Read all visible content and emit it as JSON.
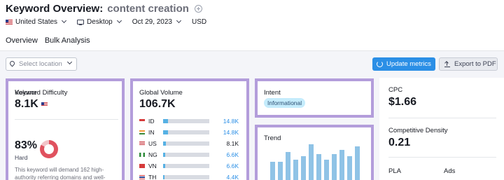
{
  "header": {
    "title": "Keyword Overview:",
    "keyword": "content creation",
    "filters": {
      "country": "United States",
      "device": "Desktop",
      "date": "Oct 29, 2023",
      "currency": "USD"
    }
  },
  "tabs": [
    {
      "label": "Overview",
      "active": true
    },
    {
      "label": "Bulk Analysis",
      "active": false
    }
  ],
  "toolbar": {
    "location_placeholder": "Select location",
    "update_label": "Update metrics",
    "export_label": "Export to PDF"
  },
  "volume": {
    "label": "Volume",
    "value": "8.1K",
    "kd_label": "Keyword Difficulty",
    "kd_value": "83%",
    "kd_level": "Hard",
    "kd_percent": 83,
    "kd_note": "This keyword will demand 162 high-authority referring domains and well-"
  },
  "global_volume": {
    "label": "Global Volume",
    "value": "106.7K",
    "rows": [
      {
        "code": "ID",
        "value": "14.8K",
        "share": 0.14,
        "link": true,
        "flag": "id"
      },
      {
        "code": "IN",
        "value": "14.8K",
        "share": 0.14,
        "link": true,
        "flag": "in"
      },
      {
        "code": "US",
        "value": "8.1K",
        "share": 0.08,
        "link": false,
        "flag": "us"
      },
      {
        "code": "NG",
        "value": "6.6K",
        "share": 0.06,
        "link": true,
        "flag": "ng"
      },
      {
        "code": "VN",
        "value": "6.6K",
        "share": 0.06,
        "link": true,
        "flag": "vn"
      },
      {
        "code": "TH",
        "value": "4.4K",
        "share": 0.04,
        "link": true,
        "flag": "th"
      }
    ]
  },
  "intent": {
    "label": "Intent",
    "badge": "Informational"
  },
  "trend": {
    "label": "Trend",
    "values": [
      0.55,
      0.55,
      0.8,
      0.6,
      0.7,
      1.0,
      0.75,
      0.6,
      0.75,
      0.85,
      0.7,
      0.95
    ]
  },
  "metrics": {
    "cpc_label": "CPC",
    "cpc_value": "$1.66",
    "cd_label": "Competitive Density",
    "cd_value": "0.21",
    "pla_label": "PLA",
    "ads_label": "Ads"
  },
  "colors": {
    "accent": "#2b8fe6",
    "highlight_border": "#b39ddb",
    "kd_hard": "#e0525f",
    "bar_fill": "#56b1e4",
    "trend_bar": "#8fc3e6"
  }
}
